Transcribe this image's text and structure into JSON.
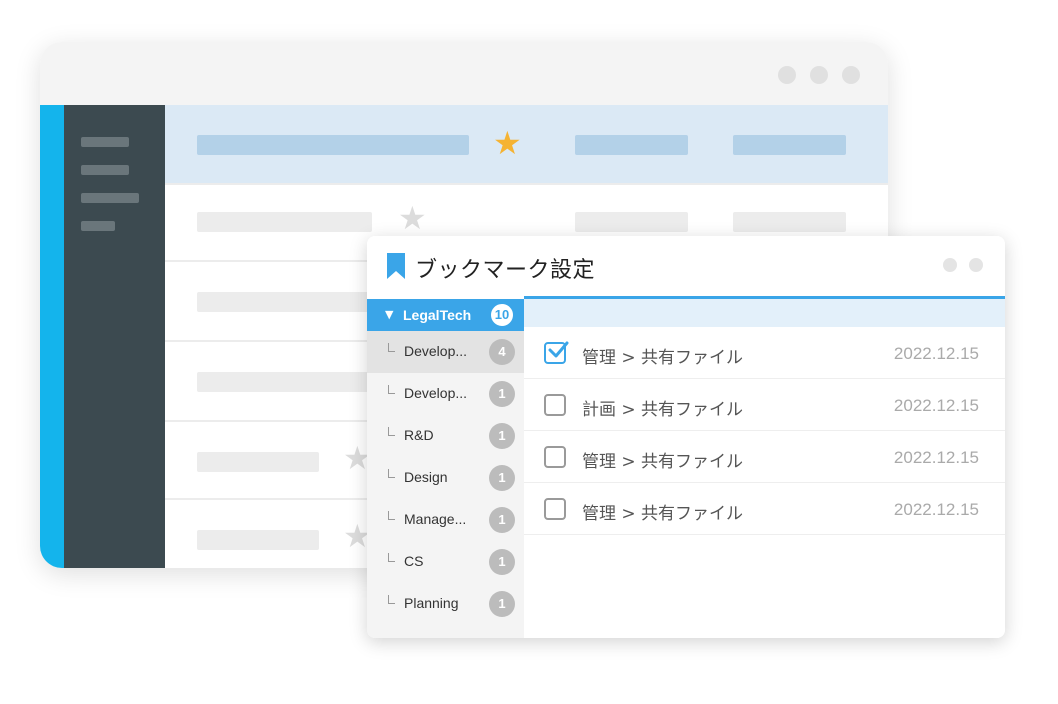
{
  "dialog": {
    "title": "ブックマーク設定",
    "accent_color": "#3aa5e8"
  },
  "tree": {
    "root": {
      "label": "LegalTech",
      "count": "10"
    },
    "items": [
      {
        "label": "Develop...",
        "count": "4"
      },
      {
        "label": "Develop...",
        "count": "1"
      },
      {
        "label": "R&D",
        "count": "1"
      },
      {
        "label": "Design",
        "count": "1"
      },
      {
        "label": "Manage...",
        "count": "1"
      },
      {
        "label": "CS",
        "count": "1"
      },
      {
        "label": "Planning",
        "count": "1"
      }
    ]
  },
  "bookmarks": [
    {
      "path": "管理 > 共有ファイル",
      "date": "2022.12.15",
      "checked": true
    },
    {
      "path": "計画 > 共有ファイル",
      "date": "2022.12.15",
      "checked": false
    },
    {
      "path": "管理 > 共有ファイル",
      "date": "2022.12.15",
      "checked": false
    },
    {
      "path": "管理 > 共有ファイル",
      "date": "2022.12.15",
      "checked": false
    }
  ],
  "colors": {
    "sidebar": "#3c4a50",
    "accent_strip": "#14b4ec",
    "star_active": "#f5b333",
    "star_inactive": "#dcdcdc"
  }
}
